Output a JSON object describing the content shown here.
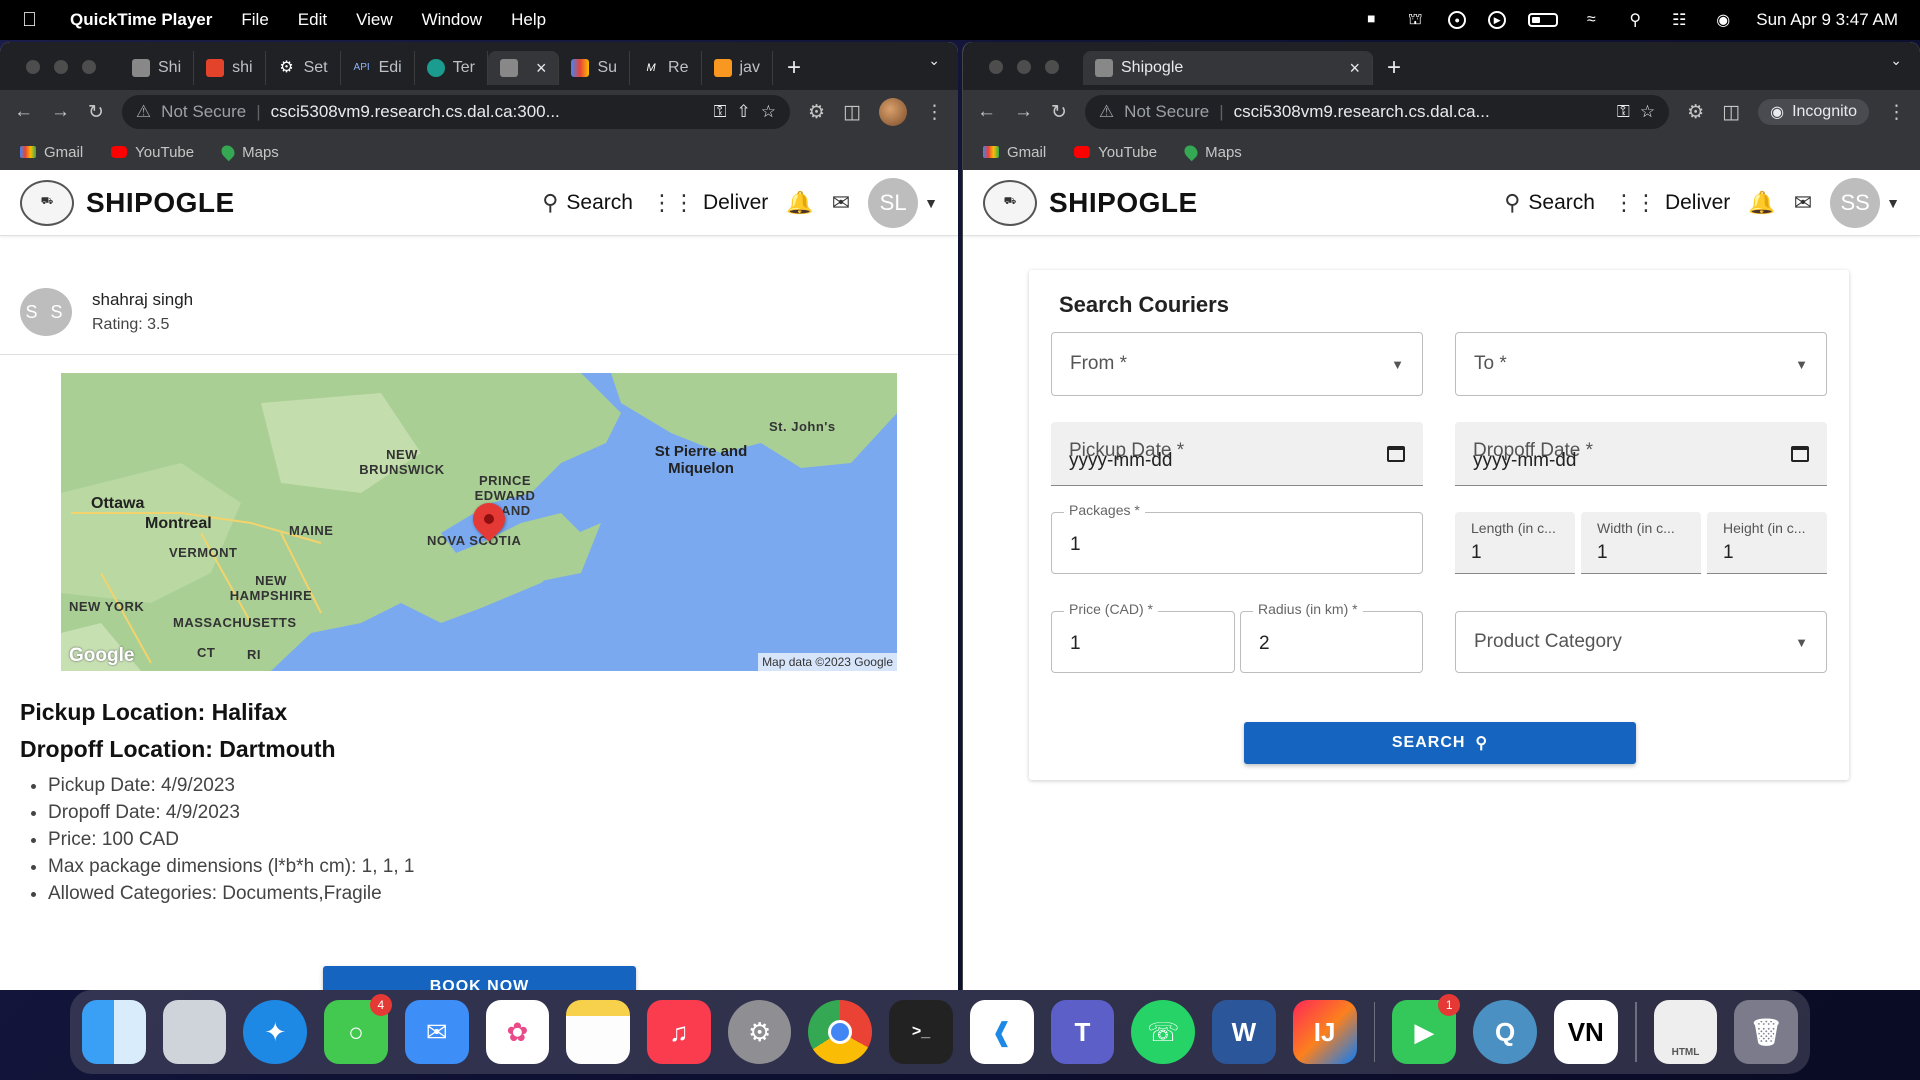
{
  "menubar": {
    "app": "QuickTime Player",
    "menus": [
      "File",
      "Edit",
      "View",
      "Window",
      "Help"
    ],
    "datetime": "Sun Apr 9  3:47 AM"
  },
  "left_browser": {
    "tabs": [
      {
        "label": "Shi",
        "icon": "shipogle-favicon"
      },
      {
        "label": "shi",
        "icon": "gitlab-icon"
      },
      {
        "label": "Set",
        "icon": "gear-icon"
      },
      {
        "label": "Edi",
        "icon": "api-icon"
      },
      {
        "label": "Ter",
        "icon": "globe-icon"
      },
      {
        "label": "",
        "icon": "shipogle-favicon",
        "active": true
      },
      {
        "label": "Su",
        "icon": "colorful-icon"
      },
      {
        "label": "Re",
        "icon": "medium-icon"
      },
      {
        "label": "jav",
        "icon": "java-icon"
      }
    ],
    "security": "Not Secure",
    "url": "csci5308vm9.research.cs.dal.ca:300...",
    "bookmarks": [
      "Gmail",
      "YouTube",
      "Maps"
    ]
  },
  "right_browser": {
    "tab_title": "Shipogle",
    "security": "Not Secure",
    "url": "csci5308vm9.research.cs.dal.ca...",
    "incognito_label": "Incognito",
    "bookmarks": [
      "Gmail",
      "YouTube",
      "Maps"
    ]
  },
  "header": {
    "brand": "SHIPOGLE",
    "search_label": "Search",
    "deliver_label": "Deliver"
  },
  "left_page": {
    "user_initials": "SL",
    "poster_initials": "S S",
    "poster_name": "shahraj singh",
    "poster_rating": "Rating: 3.5",
    "map": {
      "labels": [
        "Ottawa",
        "Montreal",
        "VERMONT",
        "MAINE",
        "NEW HAMPSHIRE",
        "NEW YORK",
        "MASSACHUSETTS",
        "CT",
        "RI",
        "NEW BRUNSWICK",
        "PRINCE EDWARD ISLAND",
        "NOVA SCOTIA",
        "St Pierre and Miquelon",
        "St. John's"
      ],
      "google_logo": "Google",
      "credit": "Map data ©2023 Google"
    },
    "pickup_location": "Pickup Location: Halifax",
    "dropoff_location": "Dropoff Location: Dartmouth",
    "details": [
      "Pickup Date: 4/9/2023",
      "Dropoff Date: 4/9/2023",
      "Price: 100 CAD",
      "Max package dimensions (l*b*h cm): 1, 1, 1",
      "Allowed Categories: Documents,Fragile"
    ],
    "book_button": "BOOK NOW"
  },
  "right_page": {
    "user_initials": "SS",
    "title": "Search Couriers",
    "from_placeholder": "From *",
    "to_placeholder": "To *",
    "pickup_date_label": "Pickup Date *",
    "pickup_date_value": "yyyy-mm-dd",
    "dropoff_date_label": "Dropoff Date *",
    "dropoff_date_value": "yyyy-mm-dd",
    "packages_label": "Packages *",
    "packages_value": "1",
    "length_label": "Length (in c...",
    "length_value": "1",
    "width_label": "Width (in c...",
    "width_value": "1",
    "height_label": "Height (in c...",
    "height_value": "1",
    "price_label": "Price (CAD) *",
    "price_value": "1",
    "radius_label": "Radius (in km) *",
    "radius_value": "2",
    "category_placeholder": "Product Category",
    "search_button": "SEARCH"
  },
  "dock": {
    "messages_badge": "4",
    "facetime_badge": "1",
    "apps": [
      "finder-icon",
      "launchpad-icon",
      "safari-icon",
      "messages-icon",
      "mail-icon",
      "photos-icon",
      "notes-icon",
      "music-icon",
      "settings-icon",
      "chrome-icon",
      "terminal-icon",
      "vscode-icon",
      "teams-icon",
      "whatsapp-icon",
      "word-icon",
      "intellij-icon",
      "facetime-icon",
      "quicktime-icon",
      "vn-icon",
      "html-file-icon",
      "trash-icon"
    ]
  }
}
